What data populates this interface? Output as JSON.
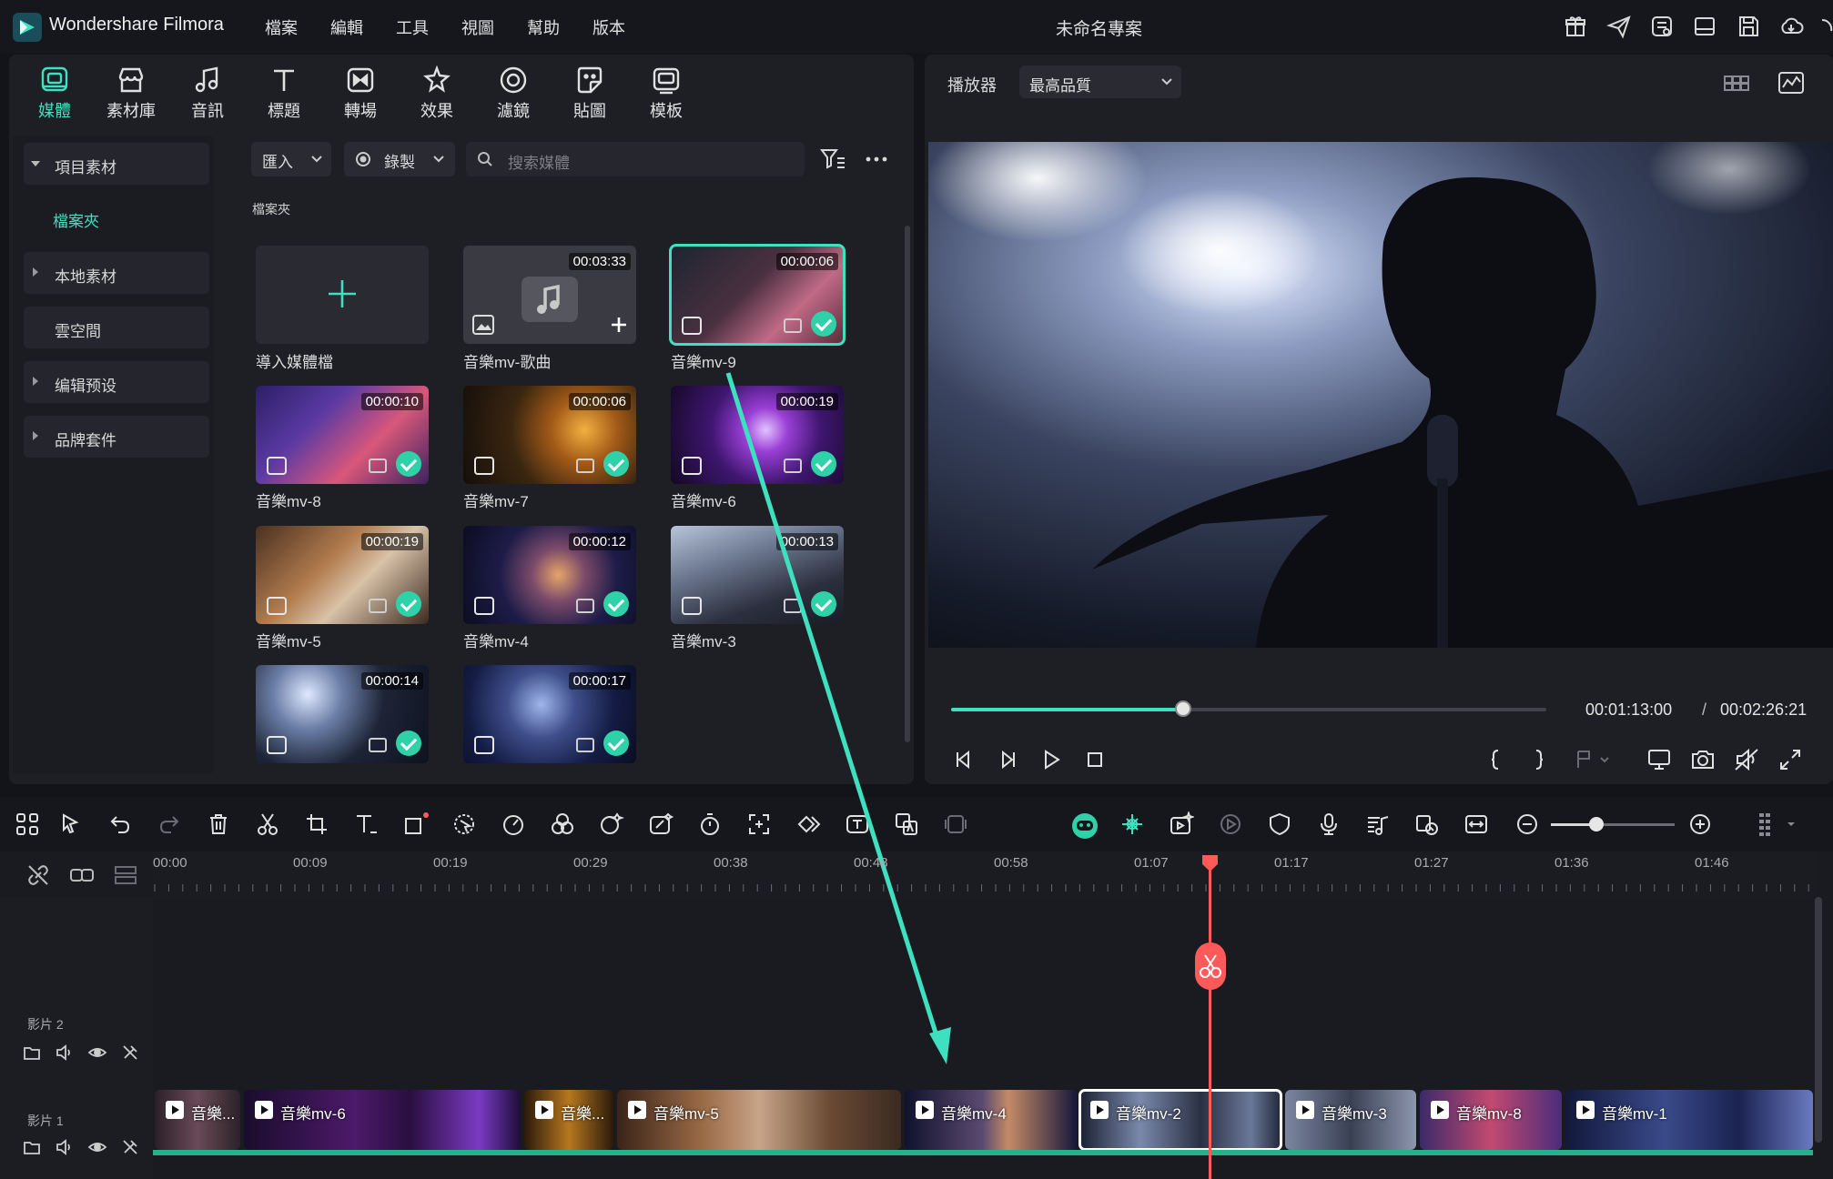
{
  "app": {
    "name": "Wondershare Filmora",
    "project_title": "未命名專案"
  },
  "menu": [
    "檔案",
    "編輯",
    "工具",
    "視圖",
    "幫助",
    "版本"
  ],
  "title_icons": [
    "gift-icon",
    "send-icon",
    "account-icon",
    "layout-icon",
    "save-icon",
    "cloud-icon"
  ],
  "tabs": [
    {
      "label": "媒體",
      "icon": "media-icon",
      "active": true
    },
    {
      "label": "素材庫",
      "icon": "store-icon"
    },
    {
      "label": "音訊",
      "icon": "music-icon"
    },
    {
      "label": "標題",
      "icon": "title-icon"
    },
    {
      "label": "轉場",
      "icon": "transition-icon"
    },
    {
      "label": "效果",
      "icon": "effects-icon"
    },
    {
      "label": "濾鏡",
      "icon": "filter-icon"
    },
    {
      "label": "貼圖",
      "icon": "sticker-icon"
    },
    {
      "label": "模板",
      "icon": "template-icon"
    }
  ],
  "sidebar": {
    "items": [
      {
        "label": "項目素材",
        "open": true
      },
      {
        "label": "本地素材"
      },
      {
        "label": "雲空間"
      },
      {
        "label": "编辑预设"
      },
      {
        "label": "品牌套件"
      }
    ],
    "sub_item": "檔案夾"
  },
  "media_toolbar": {
    "import_label": "匯入",
    "record_label": "錄製",
    "search_placeholder": "搜索媒體"
  },
  "folder_label": "檔案夾",
  "media_items": [
    {
      "label": "導入媒體檔",
      "kind": "import"
    },
    {
      "label": "音樂mv-歌曲",
      "duration": "00:03:33",
      "kind": "audio"
    },
    {
      "label": "音樂mv-9",
      "duration": "00:00:06",
      "kind": "video",
      "selected": true,
      "added": true
    },
    {
      "label": "音樂mv-8",
      "duration": "00:00:10",
      "kind": "video",
      "added": true
    },
    {
      "label": "音樂mv-7",
      "duration": "00:00:06",
      "kind": "video",
      "added": true
    },
    {
      "label": "音樂mv-6",
      "duration": "00:00:19",
      "kind": "video",
      "added": true
    },
    {
      "label": "音樂mv-5",
      "duration": "00:00:19",
      "kind": "video",
      "added": true
    },
    {
      "label": "音樂mv-4",
      "duration": "00:00:12",
      "kind": "video",
      "added": true
    },
    {
      "label": "音樂mv-3",
      "duration": "00:00:13",
      "kind": "video",
      "added": true
    },
    {
      "label": "",
      "duration": "00:00:14",
      "kind": "video",
      "added": true
    },
    {
      "label": "",
      "duration": "00:00:17",
      "kind": "video",
      "added": true
    }
  ],
  "player": {
    "label": "播放器",
    "quality": "最高品質",
    "current_time": "00:01:13:00",
    "separator": "/",
    "total_time": "00:02:26:21",
    "progress_fraction": 0.39
  },
  "timeline": {
    "ruler_ticks": [
      "00:00",
      "00:09",
      "00:19",
      "00:29",
      "00:38",
      "00:48",
      "00:58",
      "01:07",
      "01:17",
      "01:27",
      "01:36",
      "01:46"
    ],
    "tracks": [
      {
        "label": "影片 2"
      },
      {
        "label": "影片 1"
      }
    ],
    "clips": [
      {
        "label": "音樂..."
      },
      {
        "label": "音樂mv-6"
      },
      {
        "label": "音樂..."
      },
      {
        "label": "音樂mv-5"
      },
      {
        "label": "音樂mv-4"
      },
      {
        "label": "音樂mv-2",
        "selected": true
      },
      {
        "label": "音樂mv-3"
      },
      {
        "label": "音樂mv-8"
      },
      {
        "label": "音樂mv-1"
      }
    ],
    "zoom_fraction": 0.37
  },
  "colors": {
    "accent": "#3ee0c0",
    "playhead": "#ff5a5a",
    "track_green": "#24b28a"
  }
}
